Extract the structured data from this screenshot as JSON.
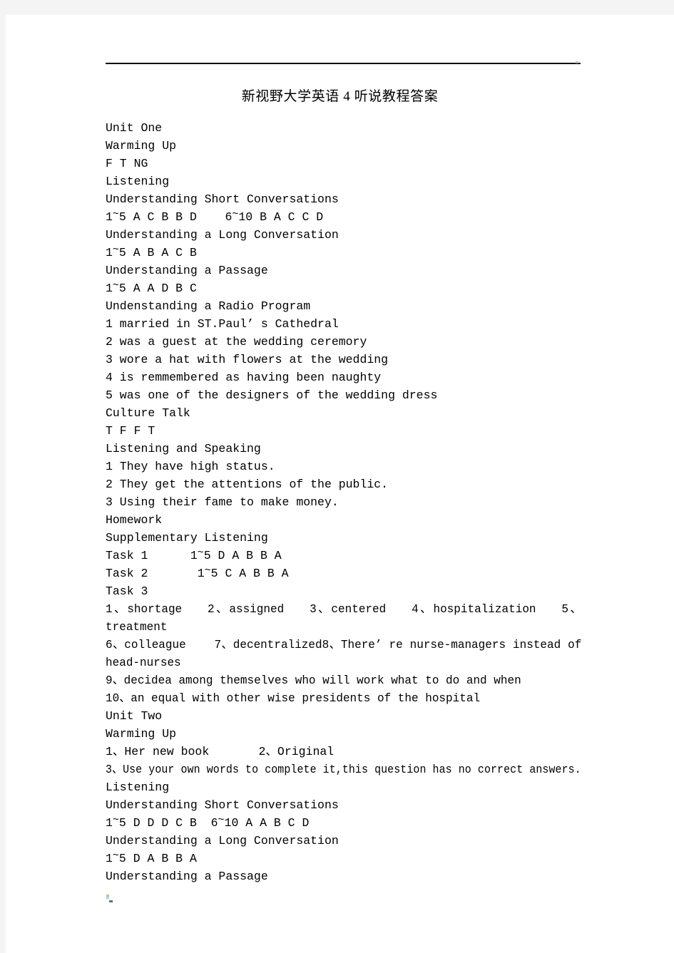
{
  "page": {
    "background_color": "#f4f4f4",
    "sheet_color": "#ffffff",
    "text_color": "#000000"
  },
  "header": {
    "rule_color": "#000000",
    "title": "新视野大学英语 4 听说教程答案"
  },
  "body_lines": [
    {
      "id": "unit-one-heading",
      "text": "Unit One"
    },
    {
      "id": "warming-up-heading-1",
      "text": "Warming Up"
    },
    {
      "id": "warming-up-answers-1",
      "text": "F T NG"
    },
    {
      "id": "listening-heading-1",
      "text": "Listening"
    },
    {
      "id": "short-conversations-heading-1",
      "text": "Understanding Short Conversations"
    },
    {
      "id": "short-conversations-answers-1",
      "pre": "1",
      "tilde": "~",
      "post": "5 A C B B D    6",
      "tilde2": "~",
      "post2": "10 B A C C D"
    },
    {
      "id": "long-conversation-heading-1",
      "text": "Understanding a Long Conversation"
    },
    {
      "id": "long-conversation-answers-1",
      "pre": "1",
      "tilde": "~",
      "post": "5 A B A C B"
    },
    {
      "id": "passage-heading-1",
      "text": "Understanding a Passage"
    },
    {
      "id": "passage-answers-1",
      "pre": "1",
      "tilde": "~",
      "post": "5 A A D B C"
    },
    {
      "id": "radio-program-heading-1",
      "text": "Undenstanding a Radio Program"
    },
    {
      "id": "radio-answer-1",
      "text": "1 married in ST.Paul’ s Cathedral"
    },
    {
      "id": "radio-answer-2",
      "text": "2 was a guest at the wedding ceremory"
    },
    {
      "id": "radio-answer-3",
      "text": "3 wore a hat with flowers at the wedding"
    },
    {
      "id": "radio-answer-4",
      "text": "4 is remmembered as having been naughty"
    },
    {
      "id": "radio-answer-5",
      "text": "5 was one of the designers of the wedding dress"
    },
    {
      "id": "culture-talk-heading-1",
      "text": "Culture Talk"
    },
    {
      "id": "culture-talk-answers-1",
      "text": "T F F T"
    },
    {
      "id": "listening-speaking-heading-1",
      "text": "Listening and Speaking"
    },
    {
      "id": "listening-speaking-answer-1",
      "text": "1 They have high status."
    },
    {
      "id": "listening-speaking-answer-2",
      "text": "2 They get the attentions of the public."
    },
    {
      "id": "listening-speaking-answer-3",
      "text": "3 Using their fame to make money."
    },
    {
      "id": "homework-heading-1",
      "text": "Homework"
    },
    {
      "id": "supplementary-listening-heading-1",
      "text": "Supplementary Listening"
    },
    {
      "id": "task-1-answers",
      "pre": "Task 1      1",
      "tilde": "~",
      "post": "5 D A B B A"
    },
    {
      "id": "task-2-answers",
      "pre": "Task 2       1",
      "tilde": "~",
      "post": "5 C A B B A"
    },
    {
      "id": "task-3-heading",
      "text": "Task 3"
    }
  ],
  "task3_paragraphs": [
    {
      "id": "task-3-items-1-5",
      "text": "1、shortage   2、assigned   3、centered   4、hospitalization   5、treatment"
    },
    {
      "id": "task-3-items-6-8",
      "text": "6、colleague    7、decentralized8、There’ re nurse-managers instead of head-nurses"
    },
    {
      "id": "task-3-item-9",
      "text": "9、decidea among themselves who will work what to do and when"
    },
    {
      "id": "task-3-item-10",
      "text": "10、an equal with other wise presidents of the hospital"
    }
  ],
  "body_lines_2": [
    {
      "id": "unit-two-heading",
      "text": "Unit Two"
    },
    {
      "id": "warming-up-heading-2",
      "text": "Warming Up"
    },
    {
      "id": "warming-up-answer-2-1",
      "text": "1、Her new book       2、Original"
    }
  ],
  "warming_up_2_line3": {
    "id": "warming-up-answer-2-3",
    "text": "3、Use your own words to complete it,this question has no correct answers."
  },
  "body_lines_3": [
    {
      "id": "listening-heading-2",
      "text": "Listening"
    },
    {
      "id": "short-conversations-heading-2",
      "text": "Understanding Short Conversations"
    },
    {
      "id": "short-conversations-answers-2",
      "pre": "1",
      "tilde": "~",
      "post": "5 D D D C B  6",
      "tilde2": "~",
      "post2": "10 A A B C D"
    },
    {
      "id": "long-conversation-heading-2",
      "text": "Understanding a Long Conversation"
    },
    {
      "id": "long-conversation-answers-2",
      "pre": "1",
      "tilde": "~",
      "post": "5 D A B B A"
    },
    {
      "id": "passage-heading-2",
      "text": "Understanding a Passage"
    }
  ]
}
